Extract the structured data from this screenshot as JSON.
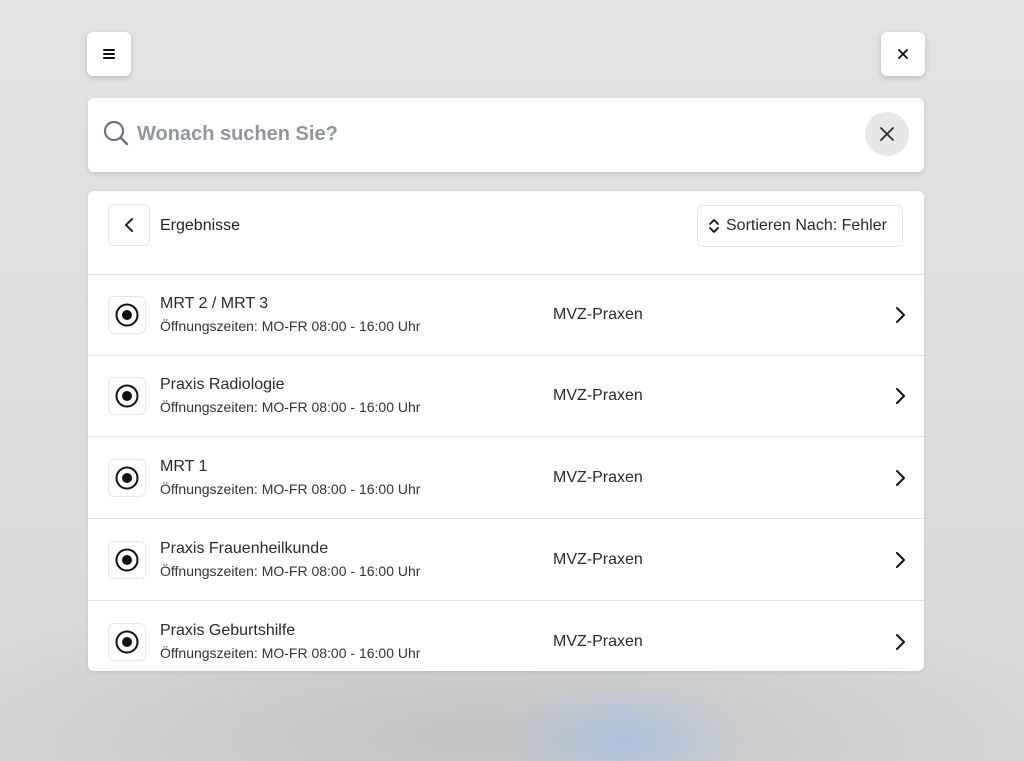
{
  "search": {
    "placeholder": "Wonach suchen Sie?",
    "value": ""
  },
  "header": {
    "title": "Ergebnisse",
    "sort_label": "Sortieren Nach: Fehler"
  },
  "results": [
    {
      "title": "MRT 2 / MRT 3",
      "hours": "Öffnungszeiten: MO-FR 08:00 - 16:00 Uhr",
      "category": "MVZ-Praxen"
    },
    {
      "title": "Praxis Radiologie",
      "hours": "Öffnungszeiten: MO-FR 08:00 - 16:00 Uhr",
      "category": "MVZ-Praxen"
    },
    {
      "title": "MRT 1",
      "hours": "Öffnungszeiten: MO-FR 08:00 - 16:00 Uhr",
      "category": "MVZ-Praxen"
    },
    {
      "title": "Praxis Frauenheilkunde",
      "hours": "Öffnungszeiten: MO-FR 08:00 - 16:00 Uhr",
      "category": "MVZ-Praxen"
    },
    {
      "title": "Praxis Geburtshilfe",
      "hours": "Öffnungszeiten: MO-FR 08:00 - 16:00 Uhr",
      "category": "MVZ-Praxen"
    }
  ],
  "icons": {
    "menu": "hamburger-icon",
    "close": "close-icon",
    "search": "search-icon",
    "clear": "clear-icon",
    "back": "chevron-left-icon",
    "sort": "sort-icon",
    "location": "location-target-icon",
    "row_arrow": "chevron-right-icon"
  }
}
